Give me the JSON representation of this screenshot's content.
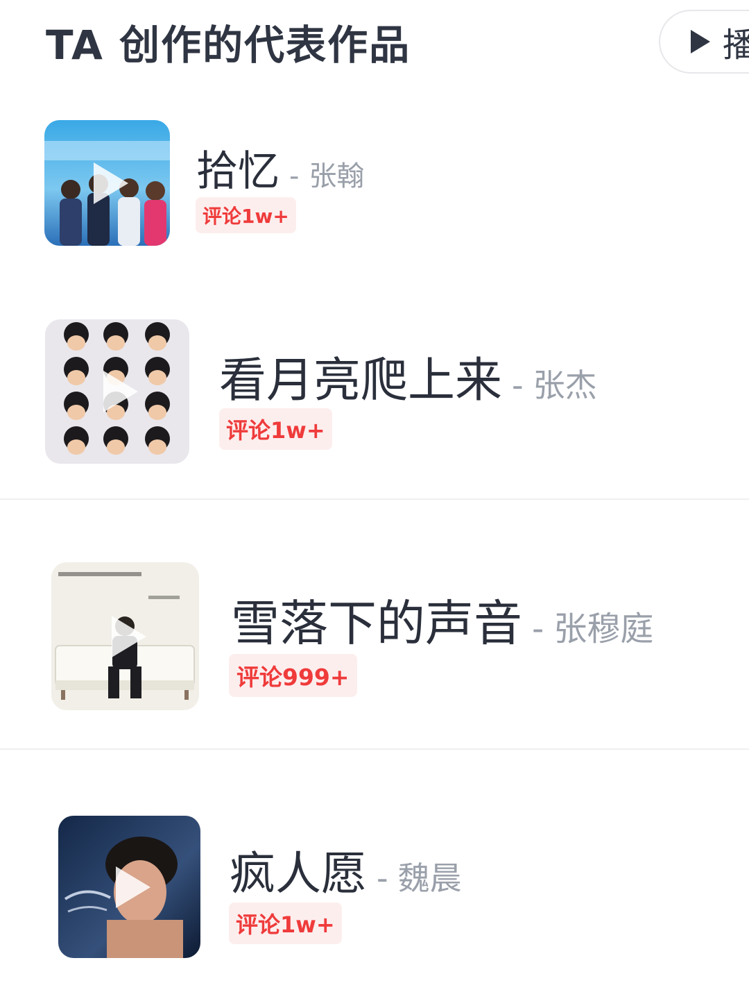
{
  "header": {
    "title": "TA 创作的代表作品",
    "play_all_label": "播"
  },
  "songs": [
    {
      "title": "拾忆",
      "separator": "-",
      "artist": "张翰",
      "badge": "评论1w+",
      "cover_icon": "album-cover-stars"
    },
    {
      "title": "看月亮爬上来",
      "separator": "-",
      "artist": "张杰",
      "badge": "评论1w+",
      "cover_icon": "album-cover-faces"
    },
    {
      "title": "雪落下的声音",
      "separator": "-",
      "artist": "张穆庭",
      "badge": "评论999+",
      "cover_icon": "album-cover-sofa"
    },
    {
      "title": "疯人愿",
      "separator": "-",
      "artist": "魏晨",
      "badge": "评论1w+",
      "cover_icon": "album-cover-portrait"
    }
  ],
  "colors": {
    "title": "#2f3542",
    "badge_text": "#ef3b3b",
    "badge_bg": "#fdeeee",
    "artist": "#9aa0aa"
  }
}
